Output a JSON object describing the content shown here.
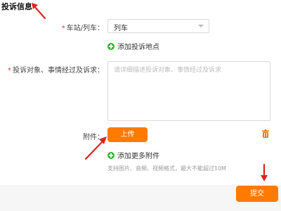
{
  "section": {
    "title": "投诉信息"
  },
  "station": {
    "required_mark": "*",
    "label": "车站/列车：",
    "selected": "列车"
  },
  "add_location": {
    "label": "添加投诉地点"
  },
  "details": {
    "required_mark": "*",
    "label": "投诉对象、事情经过及诉求：",
    "placeholder": "请详细描述投诉对象、事情经过及诉求",
    "value": ""
  },
  "attachment": {
    "label": "附件：",
    "upload_label": "上传"
  },
  "add_attachment": {
    "label": "添加更多附件"
  },
  "hint": {
    "text": "支持图片、音频、视频格式，最大不能超过10M"
  },
  "footer": {
    "submit_label": "提交"
  },
  "colors": {
    "accent": "#ff7a00",
    "required": "#e4393c",
    "success": "#2cb72c",
    "arrow": "#e02020"
  },
  "icons": [
    "plus-circle-icon",
    "chevron-down-icon",
    "trash-icon",
    "annotation-arrow-icon"
  ]
}
